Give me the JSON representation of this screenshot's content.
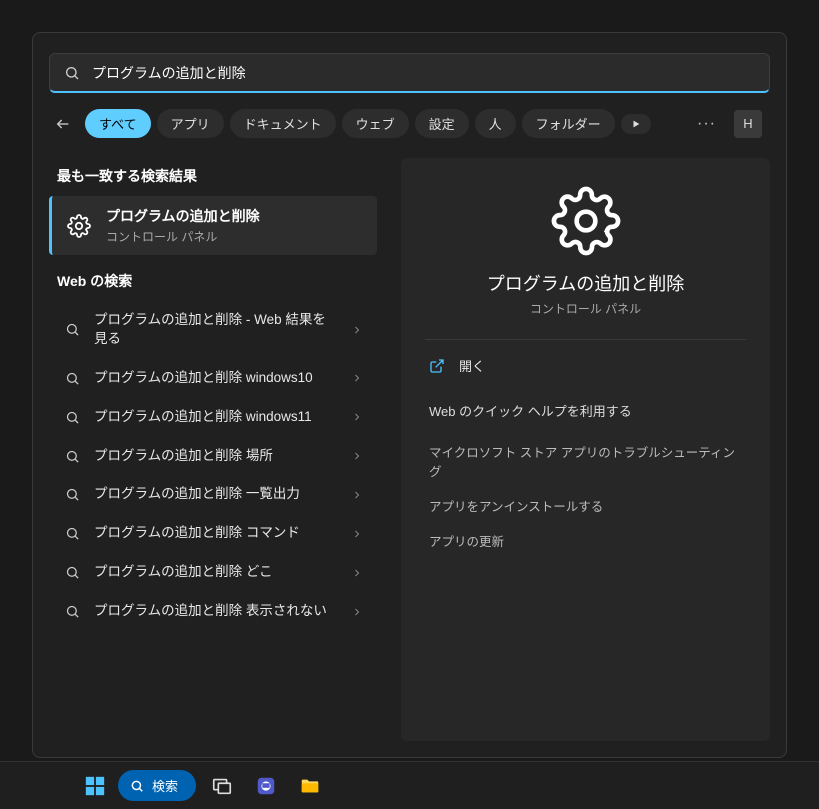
{
  "search": {
    "value": "プログラムの追加と削除"
  },
  "filters": {
    "all": "すべて",
    "apps": "アプリ",
    "documents": "ドキュメント",
    "web": "ウェブ",
    "settings": "設定",
    "people": "人",
    "folders": "フォルダー"
  },
  "avatar_initial": "H",
  "sections": {
    "best_match": "最も一致する検索結果",
    "web_search": "Web の検索"
  },
  "best_match": {
    "title": "プログラムの追加と削除",
    "subtitle": "コントロール パネル"
  },
  "web_results": [
    "プログラムの追加と削除 - Web 結果を見る",
    "プログラムの追加と削除 windows10",
    "プログラムの追加と削除 windows11",
    "プログラムの追加と削除 場所",
    "プログラムの追加と削除 一覧出力",
    "プログラムの追加と削除 コマンド",
    "プログラムの追加と削除 どこ",
    "プログラムの追加と削除 表示されない"
  ],
  "preview": {
    "title": "プログラムの追加と削除",
    "subtitle": "コントロール パネル",
    "open": "開く",
    "help_header": "Web のクイック ヘルプを利用する",
    "help_links": [
      "マイクロソフト ストア アプリのトラブルシューティング",
      "アプリをアンインストールする",
      "アプリの更新"
    ]
  },
  "taskbar": {
    "search_label": "検索"
  }
}
